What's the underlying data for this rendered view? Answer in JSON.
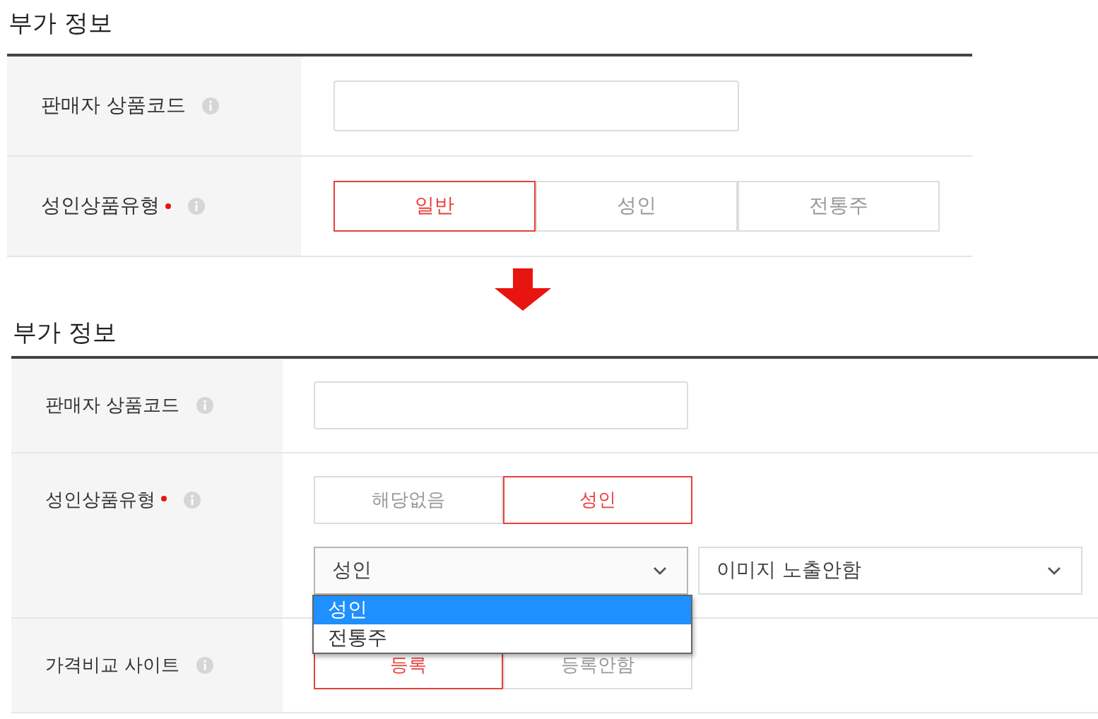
{
  "panels": [
    {
      "title": "부가 정보",
      "rows": [
        {
          "kind": "input",
          "label": "판매자 상품코드",
          "required": false
        },
        {
          "kind": "segmented",
          "label": "성인상품유형",
          "required": true,
          "options": [
            {
              "label": "일반",
              "selected": true
            },
            {
              "label": "성인",
              "selected": false
            },
            {
              "label": "전통주",
              "selected": false
            }
          ]
        }
      ]
    },
    {
      "title": "부가 정보",
      "rows": [
        {
          "kind": "input",
          "label": "판매자 상품코드",
          "required": false
        },
        {
          "kind": "segmented",
          "label": "성인상품유형",
          "required": true,
          "options": [
            {
              "label": "해당없음",
              "selected": false
            },
            {
              "label": "성인",
              "selected": true
            }
          ],
          "selects": [
            {
              "value": "성인",
              "open": true,
              "options": [
                {
                  "label": "성인",
                  "selected": true
                },
                {
                  "label": "전통주",
                  "selected": false
                }
              ]
            },
            {
              "value": "이미지 노출안함",
              "open": false
            }
          ]
        },
        {
          "kind": "segmented",
          "label": "가격비교 사이트",
          "required": false,
          "options": [
            {
              "label": "등록",
              "selected": true
            },
            {
              "label": "등록안함",
              "selected": false
            }
          ]
        }
      ]
    }
  ]
}
